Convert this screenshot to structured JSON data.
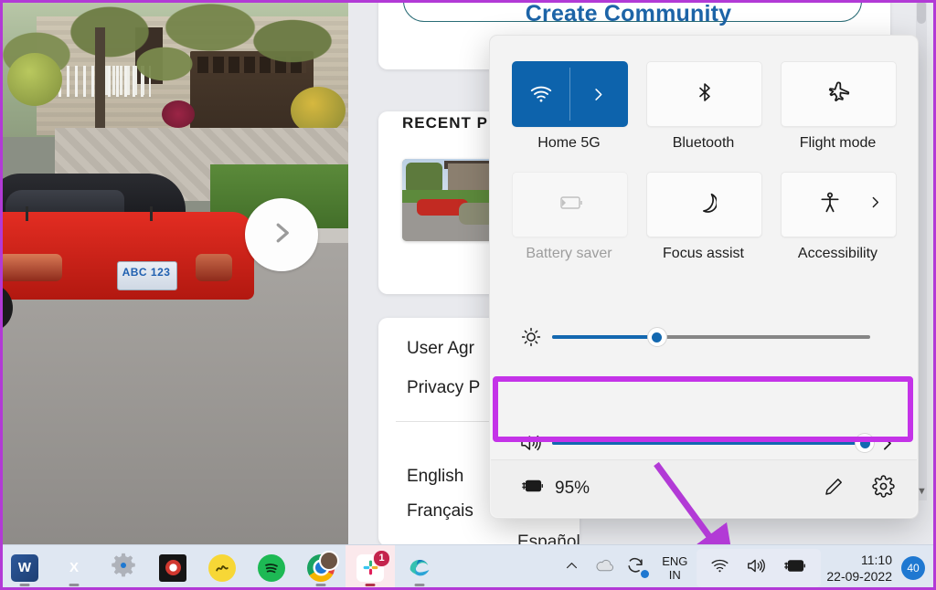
{
  "app": {
    "create_title": "Create Community",
    "recent_title": "RECENT P",
    "links": [
      "User Agr",
      "Privacy P"
    ],
    "languages": [
      "English",
      "Français",
      "Español"
    ]
  },
  "photo": {
    "plate_text": "ABC 123",
    "next_icon": "chevron-right-icon"
  },
  "quick_settings": {
    "tiles": [
      {
        "label": "Home 5G",
        "icon": "wifi-icon",
        "state": "on",
        "has_chevron": true,
        "split": true
      },
      {
        "label": "Bluetooth",
        "icon": "bluetooth-icon",
        "state": "off",
        "has_chevron": false,
        "split": false
      },
      {
        "label": "Flight mode",
        "icon": "airplane-icon",
        "state": "off",
        "has_chevron": false,
        "split": false
      },
      {
        "label": "Battery saver",
        "icon": "battery-icon",
        "state": "disabled",
        "has_chevron": false,
        "split": false
      },
      {
        "label": "Focus assist",
        "icon": "moon-icon",
        "state": "off",
        "has_chevron": false,
        "split": false
      },
      {
        "label": "Accessibility",
        "icon": "accessibility-icon",
        "state": "off",
        "has_chevron": true,
        "split": false
      }
    ],
    "brightness": {
      "icon": "brightness-icon",
      "value": 33
    },
    "volume": {
      "icon": "volume-icon",
      "value": 100,
      "chevron": "chevron-right-icon"
    },
    "footer": {
      "battery_icon": "battery-charging-icon",
      "battery_text": "95%",
      "edit_icon": "pencil-icon",
      "settings_icon": "gear-icon"
    },
    "highlight_color": "#c433e8"
  },
  "taskbar": {
    "apps": [
      {
        "name": "word",
        "glyph": "W",
        "color": "#2b579a",
        "running": true,
        "badge": ""
      },
      {
        "name": "excel",
        "glyph": "X",
        "color": "#217346",
        "running": true,
        "badge": ""
      },
      {
        "name": "settings",
        "glyph": "",
        "color": "#a9adb6",
        "running": false,
        "badge": ""
      },
      {
        "name": "opera",
        "glyph": "",
        "color": "#1f1f1f",
        "running": false,
        "badge": ""
      },
      {
        "name": "notes",
        "glyph": "",
        "color": "#f5d32f",
        "running": false,
        "badge": ""
      },
      {
        "name": "spotify",
        "glyph": "",
        "color": "#1db954",
        "running": false,
        "badge": ""
      },
      {
        "name": "chrome",
        "glyph": "",
        "color": "#f4b400",
        "running": true,
        "badge": ""
      },
      {
        "name": "slack",
        "glyph": "",
        "color": "#ffffff",
        "running": true,
        "badge": "1"
      },
      {
        "name": "edge",
        "glyph": "",
        "color": "#1a8ad4",
        "running": true,
        "badge": ""
      }
    ],
    "tray": {
      "chevron_up": "chevron-up-icon",
      "cloud_icon": "onedrive-icon",
      "sync_icon": "sync-icon",
      "language_line1": "ENG",
      "language_line2": "IN",
      "wifi_icon": "wifi-icon",
      "volume_icon": "volume-icon",
      "battery_icon": "battery-charging-icon",
      "time": "11:10",
      "date": "22-09-2022",
      "notification_count": "40"
    }
  }
}
